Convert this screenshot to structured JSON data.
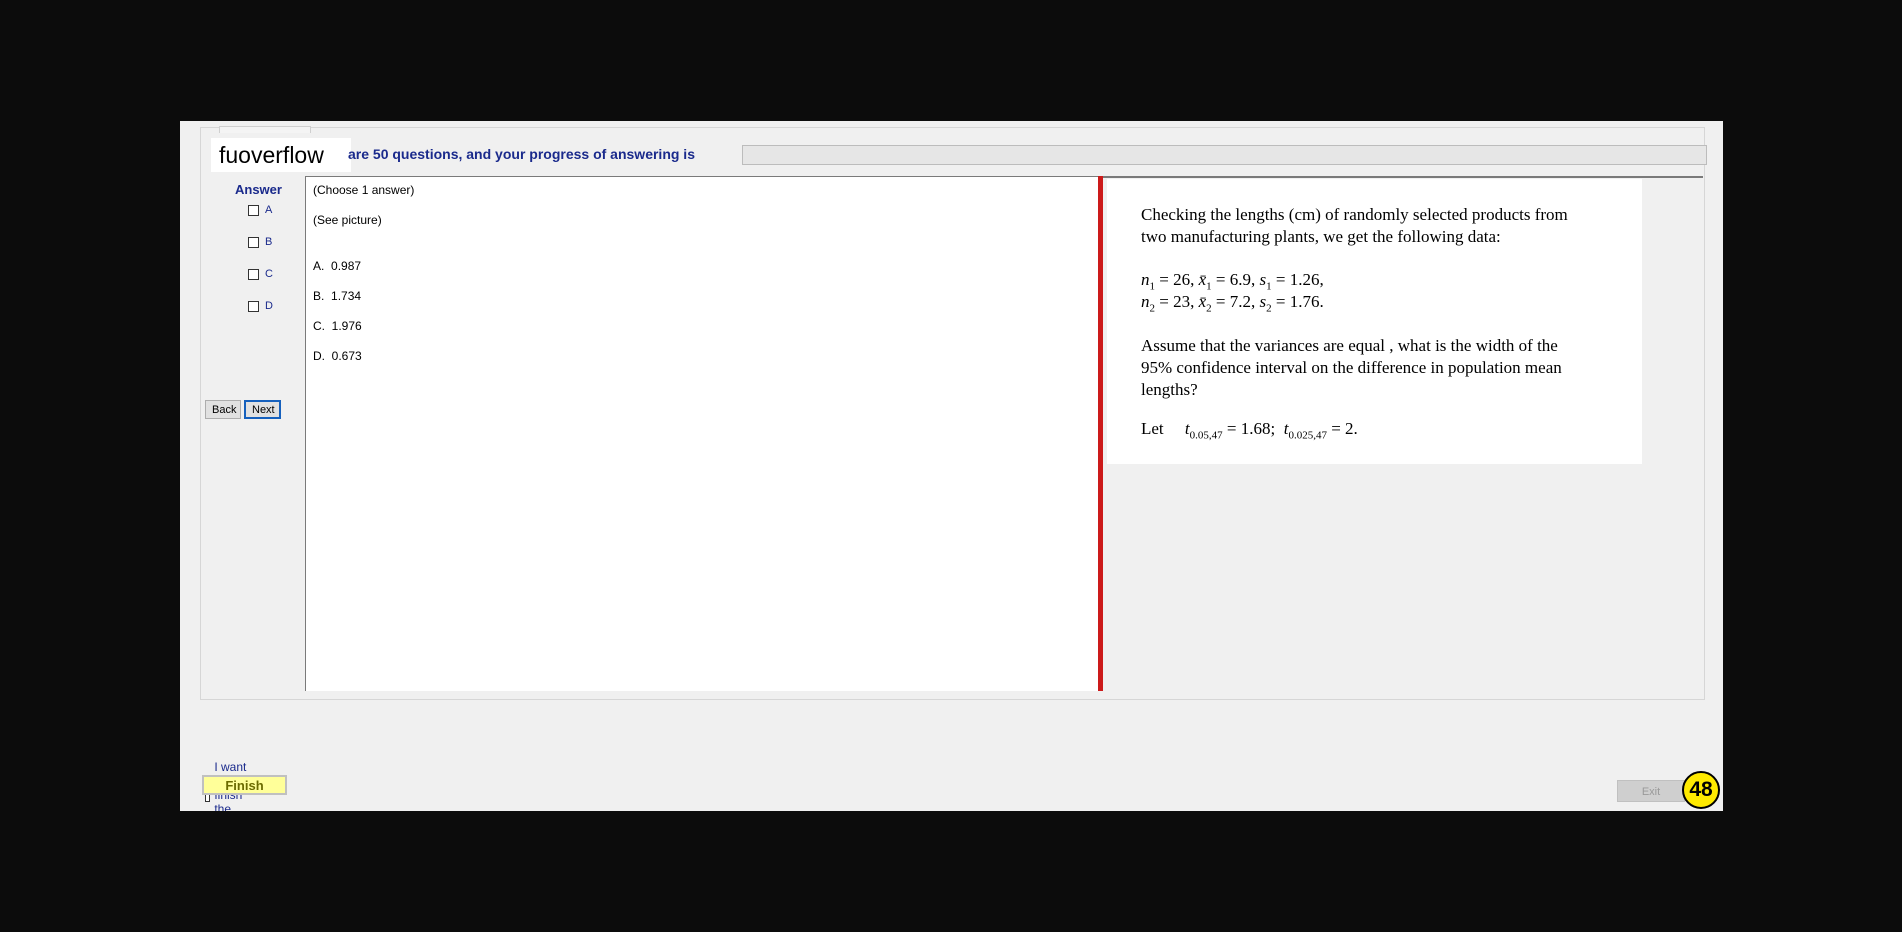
{
  "header": {
    "brand": "fuoverflow",
    "progress_text": "are 50 questions, and your progress of answering is",
    "progress_fraction": 0
  },
  "answer_panel": {
    "title": "Answer",
    "options": [
      {
        "label": "A",
        "checked": false
      },
      {
        "label": "B",
        "checked": false
      },
      {
        "label": "C",
        "checked": false
      },
      {
        "label": "D",
        "checked": false
      }
    ]
  },
  "nav": {
    "back_label": "Back",
    "next_label": "Next"
  },
  "question": {
    "instruction": "(Choose 1 answer)",
    "body": "(See picture)",
    "choices": [
      {
        "letter": "A.",
        "value": "0.987"
      },
      {
        "letter": "B.",
        "value": "1.734"
      },
      {
        "letter": "C.",
        "value": "1.976"
      },
      {
        "letter": "D.",
        "value": "0.673"
      }
    ]
  },
  "picture": {
    "line1": "Checking the lengths (cm) of randomly selected products from",
    "line2": "two manufacturing plants, we get the following data:",
    "data1": {
      "n": "n",
      "n_sub": "1",
      "n_val": " = 26, ",
      "x": "x̄",
      "x_sub": "1",
      "x_val": " = 6.9, ",
      "s": "s",
      "s_sub": "1",
      "s_val": " = 1.26,"
    },
    "data2": {
      "n": "n",
      "n_sub": "2",
      "n_val": " = 23, ",
      "x": "x̄",
      "x_sub": "2",
      "x_val": " = 7.2, ",
      "s": "s",
      "s_sub": "2",
      "s_val": " = 1.76."
    },
    "line3": "Assume that the variances are equal , what is the width of the",
    "line4": "95% confidence interval on the difference in population mean",
    "line5": "lengths?",
    "let": "Let",
    "t1": "t",
    "t1_sub": "0.05,47",
    "t1_val": " = 1.68;",
    "t2": "t",
    "t2_sub": "0.025,47",
    "t2_val": " = 2."
  },
  "footer": {
    "finish_check_label": "I want to finish the exam.",
    "finish_label": "Finish",
    "exit_label": "Exit",
    "counter": "48"
  }
}
